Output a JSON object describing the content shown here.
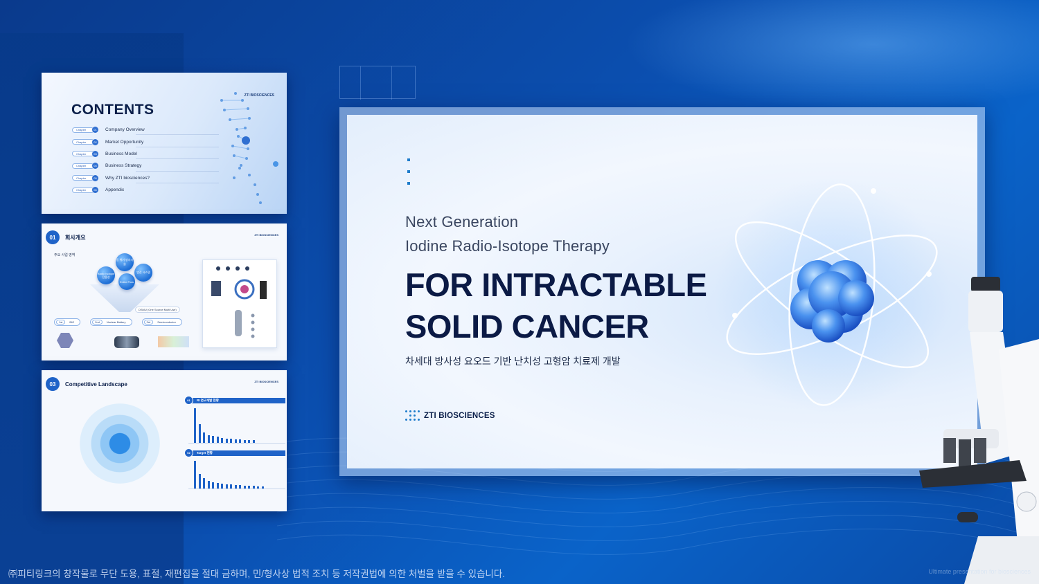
{
  "thumb1": {
    "title": "CONTENTS",
    "brand": "ZTI BIOSCIENCES",
    "items": [
      {
        "chapter": "Chapter",
        "num": "01",
        "label": "Company Overview"
      },
      {
        "chapter": "Chapter",
        "num": "02",
        "label": "Market Opportunity"
      },
      {
        "chapter": "Chapter",
        "num": "03",
        "label": "Business Model"
      },
      {
        "chapter": "Chapter",
        "num": "04",
        "label": "Business Strategy"
      },
      {
        "chapter": "Chapter",
        "num": "05",
        "label": "Why ZTI biosciences?"
      },
      {
        "chapter": "Chapter",
        "num": "06",
        "label": "Appendix"
      }
    ]
  },
  "thumb2": {
    "badge": "01",
    "heading": "회사개요",
    "brand": "ZTI BIOSCIENCES",
    "subheading": "주요 사업 영역",
    "bubbles": [
      "Radio Isotope 전용성",
      "동 위기 방사기술",
      "Entire Flow",
      "방전 시스템"
    ],
    "dsmu": "DSMU (One Source Multi Use)",
    "tags": [
      {
        "num": "1st",
        "label": "BIO"
      },
      {
        "num": "2nd",
        "label": "Nuclear Battery"
      },
      {
        "num": "3rd",
        "label": "Semiconductor"
      }
    ]
  },
  "thumb3": {
    "badge": "03",
    "heading": "Competitive Landscape",
    "brand": "ZTI BIOSCIENCES",
    "section1": {
      "num": "01",
      "label": "RI 연구개발 현황"
    },
    "section2": {
      "num": "02",
      "label": "Target 현황"
    },
    "chart1_values": [
      40,
      22,
      12,
      9,
      8,
      7,
      6,
      5,
      5,
      4,
      4,
      3,
      3,
      3
    ],
    "chart2_values": [
      38,
      20,
      14,
      10,
      9,
      8,
      7,
      6,
      6,
      5,
      5,
      4,
      4,
      4,
      3,
      3
    ]
  },
  "main": {
    "subtitle_line1": "Next Generation",
    "subtitle_line2": "Iodine Radio-Isotope Therapy",
    "title_line1": "FOR INTRACTABLE",
    "title_line2": "SOLID CANCER",
    "korean_subtitle": "차세대 방사성 요오드 기반 난치성 고형암 치료제 개발",
    "logo_text": "ZTI BIOSCIENCES"
  },
  "footer": {
    "copyright": "㈜피티링크의 창작물로 무단 도용, 표절, 재편집을 절대 금하며, 민/형사상 법적 조치 등 저작권법에 의한 처벌을 받을 수 있습니다.",
    "watermark": "Ultimate presentation for biosciences"
  },
  "colors": {
    "background": "#0b4fb0",
    "accent": "#1f63c8",
    "title": "#0b1a45"
  }
}
